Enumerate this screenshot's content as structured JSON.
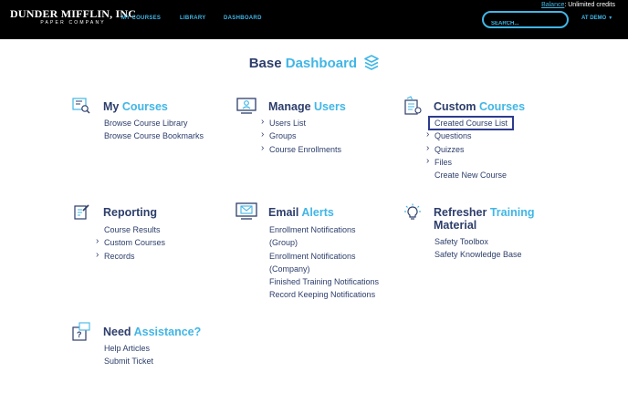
{
  "header": {
    "logo_main": "DUNDER MIFFLIN, INC",
    "logo_sub": "PAPER COMPANY",
    "nav": [
      "MY COURSES",
      "LIBRARY",
      "DASHBOARD"
    ],
    "balance_label": "Balance",
    "balance_value": ": Unlimited credits",
    "search_placeholder": "SEARCH...",
    "user_menu": "AT DEMO"
  },
  "page": {
    "title_a": "Base",
    "title_b": "Dashboard"
  },
  "cards": {
    "my_courses": {
      "a": "My",
      "b": "Courses",
      "links": [
        "Browse Course Library",
        "Browse Course Bookmarks"
      ]
    },
    "manage_users": {
      "a": "Manage",
      "b": "Users",
      "links": [
        "Users List",
        "Groups",
        "Course Enrollments"
      ]
    },
    "custom_courses": {
      "a": "Custom",
      "b": "Courses",
      "links": [
        "Created Course List",
        "Questions",
        "Quizzes",
        "Files",
        "Create New Course"
      ]
    },
    "reporting": {
      "a": "Reporting",
      "b": "",
      "links": [
        "Course Results",
        "Custom Courses",
        "Records"
      ]
    },
    "email_alerts": {
      "a": "Email",
      "b": "Alerts",
      "links": [
        "Enrollment Notifications",
        "(Group)",
        "Enrollment Notifications",
        "(Company)",
        "Finished Training Notifications",
        "Record Keeping Notifications"
      ]
    },
    "refresher": {
      "a1": "Refresher",
      "b1": "Training",
      "a2": "Material",
      "links": [
        "Safety Toolbox",
        "Safety Knowledge Base"
      ]
    },
    "assistance": {
      "a": "Need",
      "b": "Assistance?",
      "links": [
        "Help Articles",
        "Submit Ticket"
      ]
    }
  },
  "colors": {
    "navy": "#2d3e6b",
    "cyan": "#41b6e6",
    "highlight": "#2d3b8e",
    "topbar": "#000000"
  }
}
